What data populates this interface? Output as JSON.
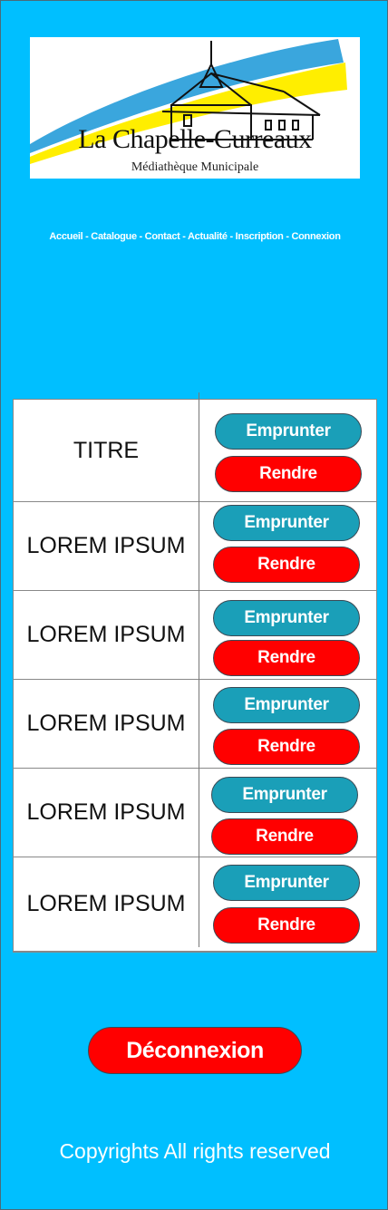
{
  "logo": {
    "title": "La Chapelle-Curreaux",
    "subtitle": "Médiathèque Municipale",
    "colors": {
      "blue": "#3aa6dd",
      "yellow": "#ffee00"
    }
  },
  "nav": {
    "items": [
      "Accueil",
      "Catalogue",
      "Contact",
      "Actualité",
      "Inscription",
      "Connexion"
    ],
    "separator": " - "
  },
  "table": {
    "rows": [
      {
        "title": "TITRE",
        "borrow_label": "Emprunter",
        "return_label": "Rendre"
      },
      {
        "title": "LOREM IPSUM",
        "borrow_label": "Emprunter",
        "return_label": "Rendre"
      },
      {
        "title": "LOREM IPSUM",
        "borrow_label": "Emprunter",
        "return_label": "Rendre"
      },
      {
        "title": "LOREM IPSUM",
        "borrow_label": "Emprunter",
        "return_label": "Rendre"
      },
      {
        "title": "LOREM IPSUM",
        "borrow_label": "Emprunter",
        "return_label": "Rendre"
      },
      {
        "title": "LOREM IPSUM",
        "borrow_label": "Emprunter",
        "return_label": "Rendre"
      }
    ]
  },
  "logout_label": "Déconnexion",
  "footer": "Copyrights All rights reserved",
  "colors": {
    "background": "#00bfff",
    "borrow": "#1a9fb8",
    "return": "#ff0000"
  }
}
